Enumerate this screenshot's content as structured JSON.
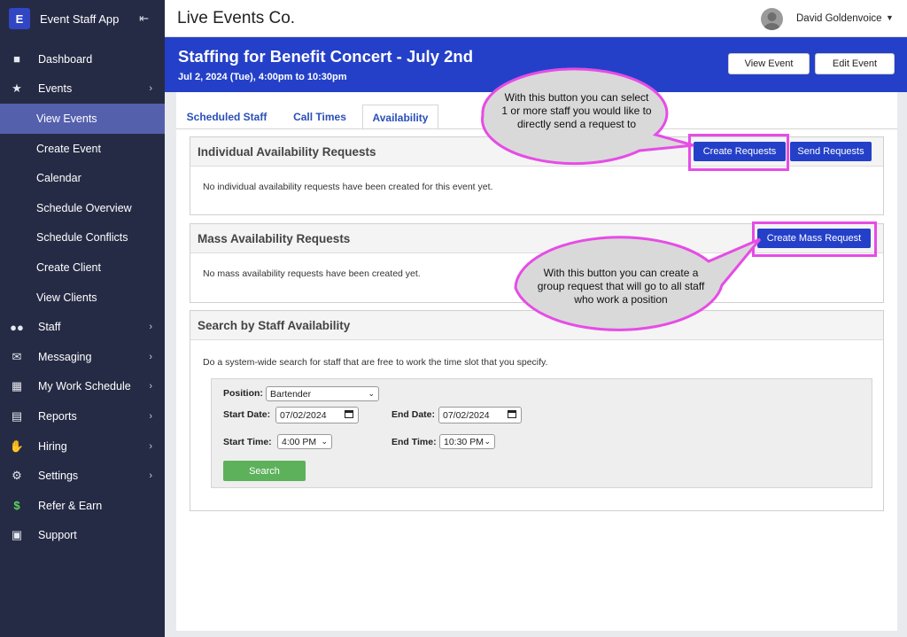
{
  "app": {
    "name": "Event Staff App",
    "logo_letter": "E",
    "company": "Live Events Co."
  },
  "user": {
    "name": "David Goldenvoice"
  },
  "sidebar": {
    "items": [
      {
        "label": "Dashboard",
        "icon": "dashboard-icon"
      },
      {
        "label": "Events",
        "icon": "star-icon"
      },
      {
        "label": "View Events"
      },
      {
        "label": "Create Event"
      },
      {
        "label": "Calendar"
      },
      {
        "label": "Schedule Overview"
      },
      {
        "label": "Schedule Conflicts"
      },
      {
        "label": "Create Client"
      },
      {
        "label": "View Clients"
      },
      {
        "label": "Staff",
        "icon": "users-icon"
      },
      {
        "label": "Messaging",
        "icon": "envelope-icon"
      },
      {
        "label": "My Work Schedule",
        "icon": "calendar-icon"
      },
      {
        "label": "Reports",
        "icon": "chart-icon"
      },
      {
        "label": "Hiring",
        "icon": "hand-icon"
      },
      {
        "label": "Settings",
        "icon": "gear-icon"
      },
      {
        "label": "Refer & Earn",
        "icon": "dollar-icon"
      },
      {
        "label": "Support",
        "icon": "support-icon"
      }
    ]
  },
  "event": {
    "title": "Staffing for Benefit Concert - July 2nd",
    "date": "Jul 2, 2024 (Tue), 4:00pm to 10:30pm",
    "view_label": "View Event",
    "edit_label": "Edit Event"
  },
  "tabs": [
    "Scheduled Staff",
    "Call Times",
    "Availability"
  ],
  "individual": {
    "title": "Individual Availability Requests",
    "empty": "No individual availability requests have been created for this event yet.",
    "create_label": "Create Requests",
    "send_label": "Send Requests"
  },
  "mass": {
    "title": "Mass Availability Requests",
    "empty": "No mass availability requests have been created yet.",
    "create_label": "Create Mass Request"
  },
  "search": {
    "title": "Search by Staff Availability",
    "description": "Do a system-wide search for staff that are free to work the time slot that you specify.",
    "position_label": "Position:",
    "position_value": "Bartender",
    "start_date_label": "Start Date:",
    "start_date_value": "07/02/2024",
    "end_date_label": "End Date:",
    "end_date_value": "07/02/2024",
    "start_time_label": "Start Time:",
    "start_time_value": "4:00 PM",
    "end_time_label": "End Time:",
    "end_time_value": "10:30 PM",
    "button_label": "Search"
  },
  "annotations": {
    "callout1": [
      "With this button you can select",
      "1 or more staff you would like to",
      "directly send a request to"
    ],
    "callout2": [
      "With this button you can create a",
      "group request that will go to all staff",
      "who work a position"
    ],
    "highlight_color": "#e64ce6"
  },
  "colors": {
    "sidebar_bg": "#262b45",
    "active_item": "#5560ad",
    "banner_bg": "#2440c8",
    "search_button": "#5cb15a"
  }
}
